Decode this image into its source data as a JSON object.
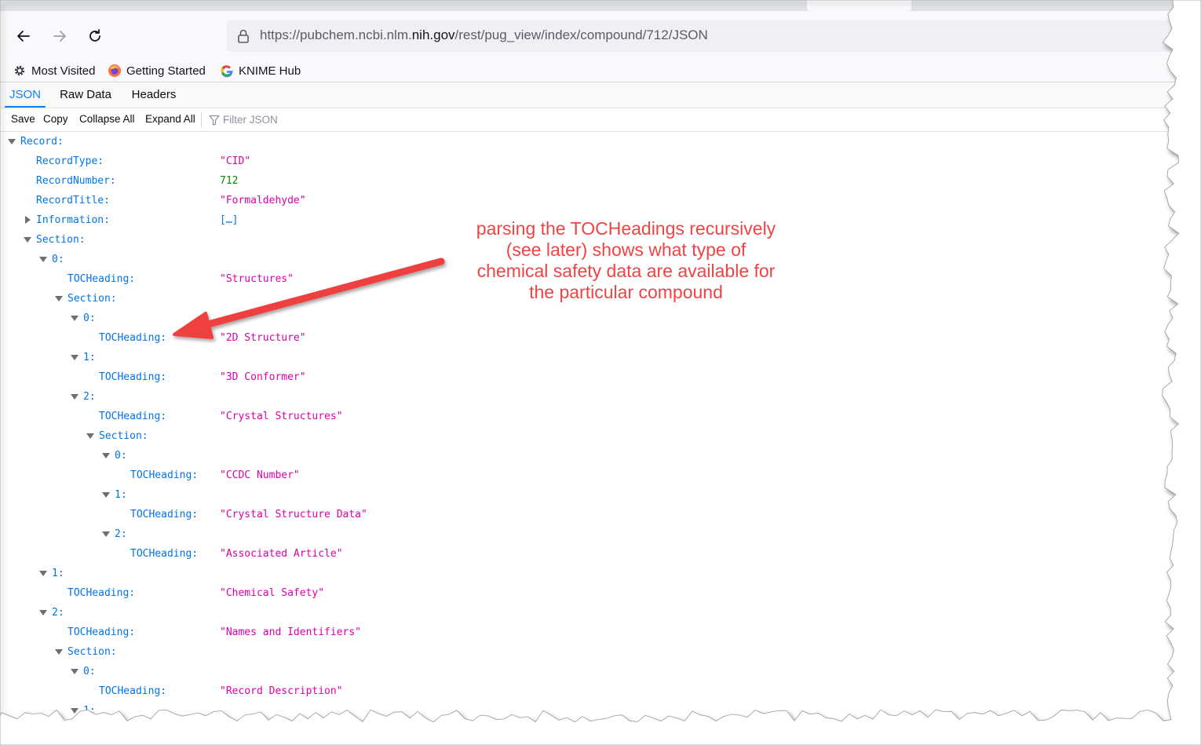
{
  "browser": {
    "url_prefix": "https://pubchem.ncbi.nlm.",
    "url_domain": "nih.gov",
    "url_suffix": "/rest/pug_view/index/compound/712/JSON",
    "bookmarks": [
      {
        "label": "Most Visited",
        "icon": "gear-icon"
      },
      {
        "label": "Getting Started",
        "icon": "firefox-icon"
      },
      {
        "label": "KNIME Hub",
        "icon": "google-icon"
      }
    ]
  },
  "viewer": {
    "tabs": [
      {
        "label": "JSON",
        "active": true
      },
      {
        "label": "Raw Data",
        "active": false
      },
      {
        "label": "Headers",
        "active": false
      }
    ],
    "toolbar": {
      "save": "Save",
      "copy": "Copy",
      "collapse_all": "Collapse All",
      "expand_all": "Expand All",
      "filter_placeholder": "Filter JSON"
    }
  },
  "tree": [
    {
      "depth": 0,
      "key": "Record:",
      "twisty": "open"
    },
    {
      "depth": 1,
      "key": "RecordType:",
      "value": "\"CID\"",
      "type": "str"
    },
    {
      "depth": 1,
      "key": "RecordNumber:",
      "value": "712",
      "type": "num"
    },
    {
      "depth": 1,
      "key": "RecordTitle:",
      "value": "\"Formaldehyde\"",
      "type": "str"
    },
    {
      "depth": 1,
      "key": "Information:",
      "value": "[…]",
      "type": "obj",
      "twisty": "closed"
    },
    {
      "depth": 1,
      "key": "Section:",
      "twisty": "open"
    },
    {
      "depth": 2,
      "key": "0:",
      "twisty": "open"
    },
    {
      "depth": 3,
      "key": "TOCHeading:",
      "value": "\"Structures\"",
      "type": "str"
    },
    {
      "depth": 3,
      "key": "Section:",
      "twisty": "open"
    },
    {
      "depth": 4,
      "key": "0:",
      "twisty": "open"
    },
    {
      "depth": 5,
      "key": "TOCHeading:",
      "value": "\"2D Structure\"",
      "type": "str"
    },
    {
      "depth": 4,
      "key": "1:",
      "twisty": "open"
    },
    {
      "depth": 5,
      "key": "TOCHeading:",
      "value": "\"3D Conformer\"",
      "type": "str"
    },
    {
      "depth": 4,
      "key": "2:",
      "twisty": "open"
    },
    {
      "depth": 5,
      "key": "TOCHeading:",
      "value": "\"Crystal Structures\"",
      "type": "str"
    },
    {
      "depth": 5,
      "key": "Section:",
      "twisty": "open"
    },
    {
      "depth": 6,
      "key": "0:",
      "twisty": "open"
    },
    {
      "depth": 7,
      "key": "TOCHeading:",
      "value": "\"CCDC Number\"",
      "type": "str"
    },
    {
      "depth": 6,
      "key": "1:",
      "twisty": "open"
    },
    {
      "depth": 7,
      "key": "TOCHeading:",
      "value": "\"Crystal Structure Data\"",
      "type": "str"
    },
    {
      "depth": 6,
      "key": "2:",
      "twisty": "open"
    },
    {
      "depth": 7,
      "key": "TOCHeading:",
      "value": "\"Associated Article\"",
      "type": "str"
    },
    {
      "depth": 2,
      "key": "1:",
      "twisty": "open"
    },
    {
      "depth": 3,
      "key": "TOCHeading:",
      "value": "\"Chemical Safety\"",
      "type": "str"
    },
    {
      "depth": 2,
      "key": "2:",
      "twisty": "open"
    },
    {
      "depth": 3,
      "key": "TOCHeading:",
      "value": "\"Names and Identifiers\"",
      "type": "str"
    },
    {
      "depth": 3,
      "key": "Section:",
      "twisty": "open"
    },
    {
      "depth": 4,
      "key": "0:",
      "twisty": "open"
    },
    {
      "depth": 5,
      "key": "TOCHeading:",
      "value": "\"Record Description\"",
      "type": "str"
    },
    {
      "depth": 4,
      "key": "1:",
      "twisty": "open"
    }
  ],
  "annotation": {
    "lines": [
      "parsing the TOCHeadings recursively",
      "(see later) shows what type of",
      "chemical safety data are available for",
      "the particular compound"
    ],
    "color": "#f04343"
  }
}
